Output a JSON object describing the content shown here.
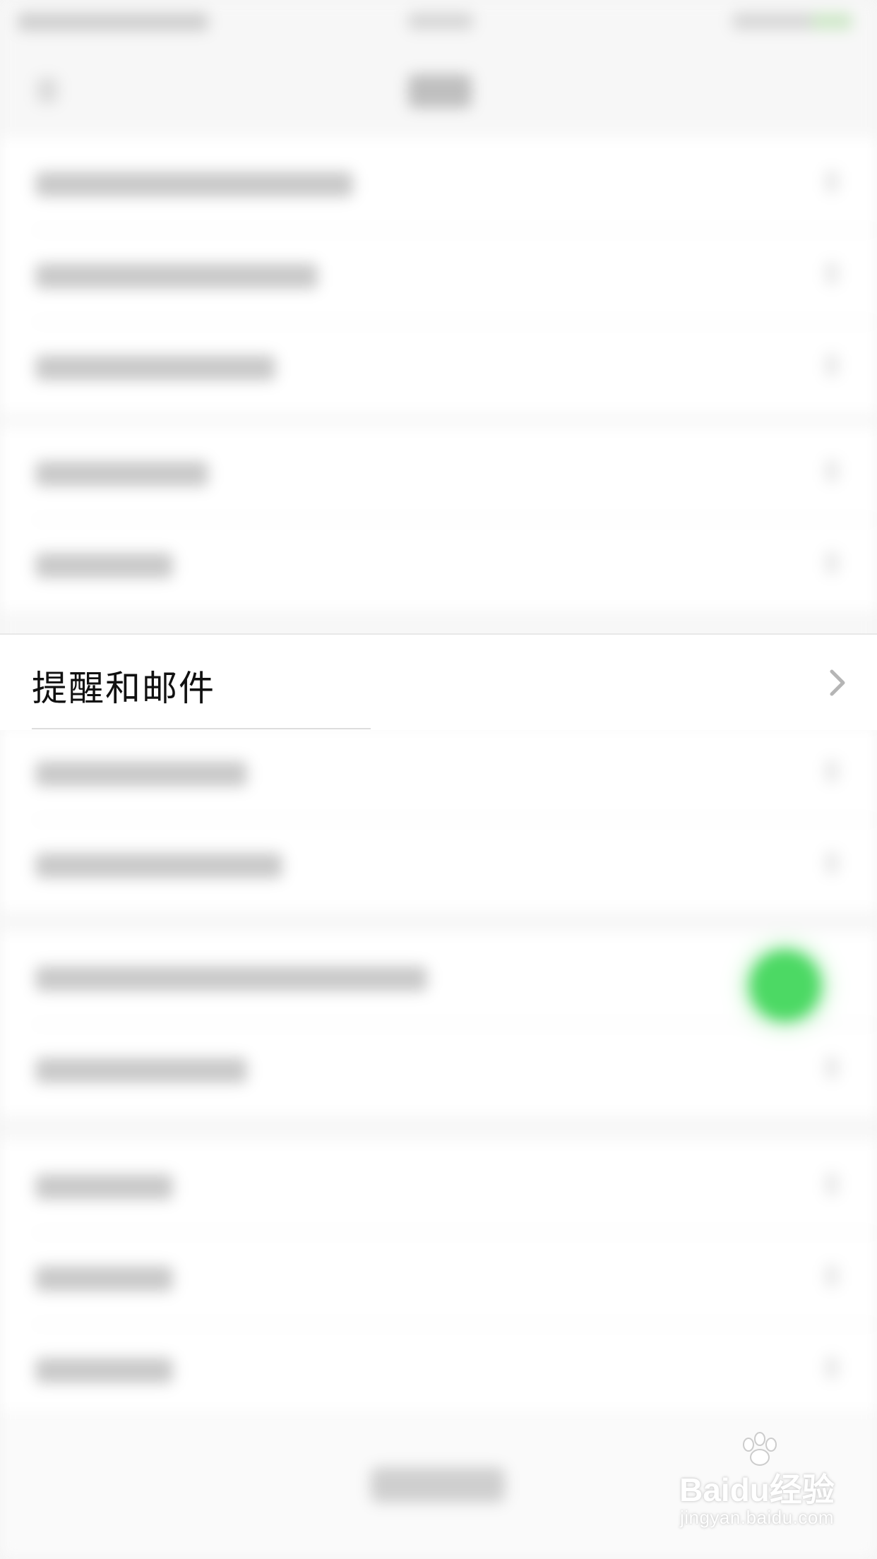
{
  "settings": {
    "highlighted_item": {
      "label": "提醒和邮件",
      "chevron_icon": "chevron-right-icon"
    }
  },
  "watermark": {
    "logo_text": "Baidu经验",
    "url": "jingyan.baidu.com",
    "icon": "paw-icon"
  },
  "colors": {
    "toggle_on": "#4cd964",
    "text": "#111111",
    "chevron": "#b5b5b5"
  }
}
